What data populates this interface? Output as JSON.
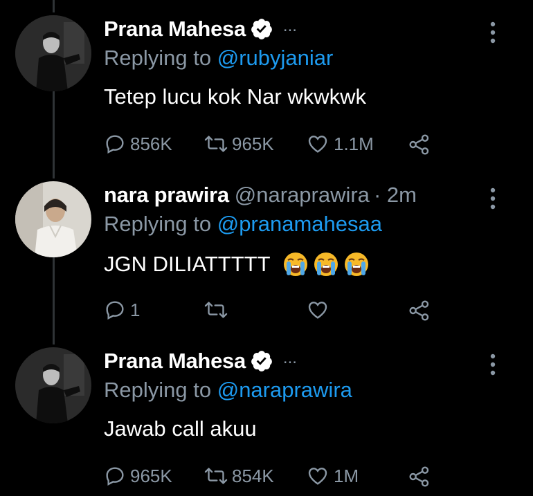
{
  "tweets": [
    {
      "name": "Prana Mahesa",
      "handle": "",
      "time": "",
      "verified": true,
      "replying_prefix": "Replying to",
      "replying_to": "@rubyjaniar",
      "text": "Tetep lucu kok Nar wkwkwk",
      "emoji": [],
      "replies": "856K",
      "retweets": "965K",
      "likes": "1.1M"
    },
    {
      "name": "nara prawira",
      "handle": "@naraprawira",
      "time": "· 2m",
      "verified": false,
      "replying_prefix": "Replying to",
      "replying_to": "@pranamahesaa",
      "text": "JGN DILIATTTTT",
      "emoji": [
        "loudly-crying-face",
        "loudly-crying-face",
        "loudly-crying-face"
      ],
      "replies": "1",
      "retweets": "",
      "likes": ""
    },
    {
      "name": "Prana Mahesa",
      "handle": "",
      "time": "",
      "verified": true,
      "replying_prefix": "Replying to",
      "replying_to": "@naraprawira",
      "text": "Jawab call akuu",
      "emoji": [],
      "replies": "965K",
      "retweets": "854K",
      "likes": "1M"
    }
  ],
  "ellipsis": "...",
  "colors": {
    "background": "#000000",
    "secondary_text": "#8b98a5",
    "mention": "#1d9bf0",
    "thread_line": "#2f3336"
  }
}
